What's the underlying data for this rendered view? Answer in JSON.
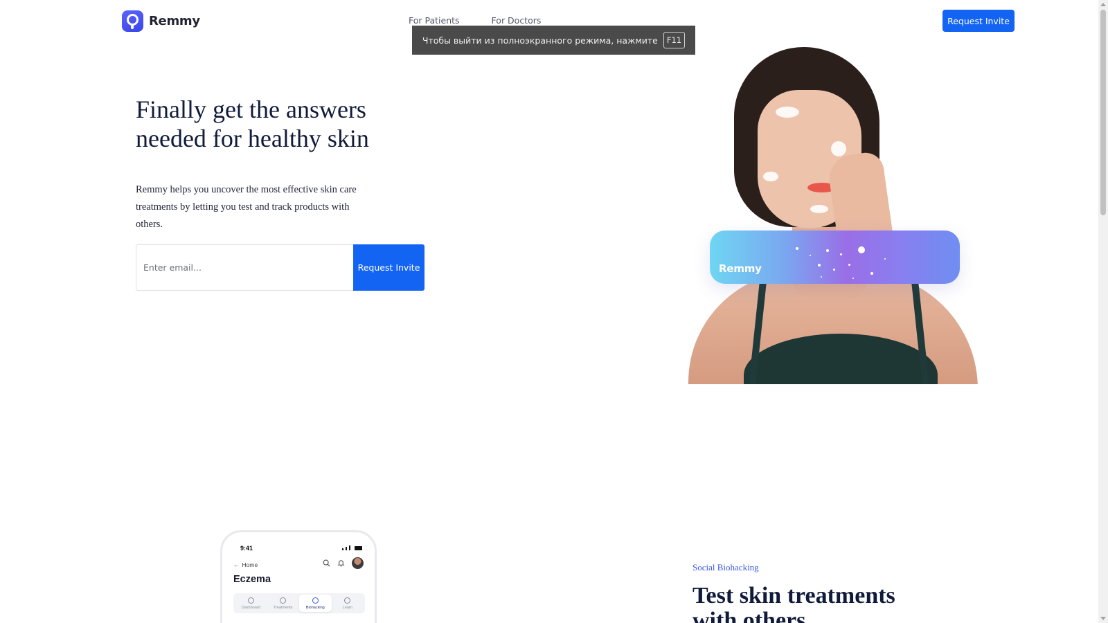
{
  "header": {
    "brand": "Remmy",
    "nav": [
      {
        "label": "For Patients"
      },
      {
        "label": "For Doctors"
      }
    ],
    "cta_label": "Request Invite"
  },
  "fullscreen_toast": {
    "message": "Чтобы выйти из полноэкранного режима, нажмите",
    "key": "F11"
  },
  "hero": {
    "title": "Finally get the answers needed for healthy skin",
    "description": "Remmy helps you uncover the most effective skin care treatments by letting you test and track products with others.",
    "email_placeholder": "Enter email...",
    "submit_label": "Request Invite",
    "card_label": "Remmy"
  },
  "phone": {
    "time": "9:41",
    "back_label": "Home",
    "title": "Eczema",
    "tabs": [
      {
        "label": "Dashboard",
        "active": false
      },
      {
        "label": "Treatments",
        "active": false
      },
      {
        "label": "Biohacking",
        "active": true
      },
      {
        "label": "Learn",
        "active": false
      }
    ]
  },
  "section2": {
    "eyebrow": "Social Biohacking",
    "title": "Test skin treatments with others"
  },
  "colors": {
    "accent": "#1464f4",
    "heading": "#101a3a",
    "eyebrow": "#3a5ae8",
    "toast_bg": "#4a4a4a"
  }
}
